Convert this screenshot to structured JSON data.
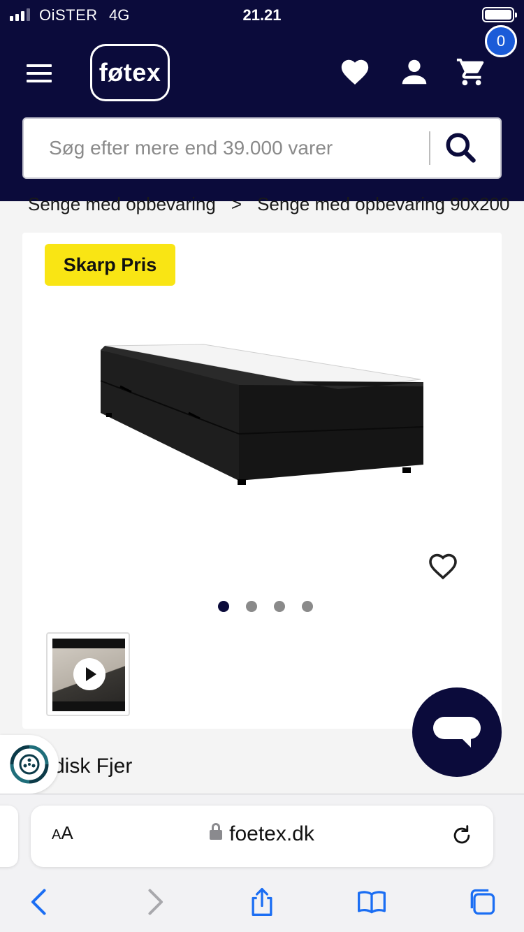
{
  "status_bar": {
    "carrier": "OiSTER",
    "network": "4G",
    "time": "21.21"
  },
  "header": {
    "logo": "føtex",
    "cart_count": "0",
    "search": {
      "placeholder": "Søg efter  mere end 39.000 varer"
    }
  },
  "breadcrumb": {
    "items": [
      "Senge med opbevaring",
      "Senge med opbevaring 90x200"
    ],
    "separator": ">"
  },
  "product": {
    "badge": "Skarp Pris",
    "gallery": {
      "image_count": 4,
      "active_index": 0
    },
    "brand_partial": "disk Fjer"
  },
  "browser": {
    "text_size_label": "AA",
    "url": "foetex.dk"
  },
  "colors": {
    "brand_navy": "#0b0b3b",
    "badge_yellow": "#f9e514",
    "cart_badge_blue": "#1b5bd8",
    "safari_blue": "#1b6ef3"
  },
  "icons": [
    "menu-icon",
    "heart-icon",
    "user-icon",
    "cart-icon",
    "search-icon",
    "chevron-right-icon",
    "heart-outline-icon",
    "play-icon",
    "chat-icon",
    "recycle-icon",
    "lock-icon",
    "reload-icon",
    "back-icon",
    "forward-icon",
    "share-icon",
    "bookmarks-icon",
    "tabs-icon"
  ]
}
